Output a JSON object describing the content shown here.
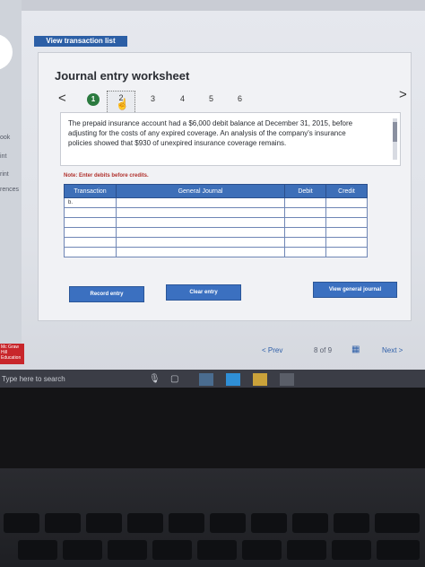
{
  "top": {
    "view_transaction_list": "View transaction list"
  },
  "sidebar": {
    "items": [
      {
        "label": "ook"
      },
      {
        "label": "int"
      },
      {
        "label": "rint"
      },
      {
        "label": "rences"
      }
    ]
  },
  "worksheet": {
    "title": "Journal entry worksheet",
    "prev_arrow": "<",
    "next_arrow": ">",
    "steps": [
      "1",
      "2",
      "3",
      "4",
      "5",
      "6"
    ],
    "current_step": 2,
    "prompt": "The prepaid insurance account had a $6,000 debit balance at December 31, 2015, before adjusting for the costs of any expired coverage. An analysis of the company's insurance policies showed that $930 of unexpired insurance coverage remains.",
    "note": "Note: Enter debits before credits.",
    "table": {
      "headers": [
        "Transaction",
        "General Journal",
        "Debit",
        "Credit"
      ],
      "rows": [
        [
          "b.",
          "",
          "",
          ""
        ],
        [
          "",
          "",
          "",
          ""
        ],
        [
          "",
          "",
          "",
          ""
        ],
        [
          "",
          "",
          "",
          ""
        ],
        [
          "",
          "",
          "",
          ""
        ],
        [
          "",
          "",
          "",
          ""
        ]
      ]
    },
    "buttons": {
      "record": "Record entry",
      "clear": "Clear entry",
      "view_general_journal": "View general journal"
    }
  },
  "footer": {
    "prev": "<  Prev",
    "page_of": "8 of 9",
    "next": "Next  >",
    "logo": "Mc Graw Hill Education"
  },
  "taskbar": {
    "search_placeholder": "Type here to search"
  },
  "colors": {
    "header_blue": "#3d6fb8",
    "button_blue": "#3b70c0",
    "step_green": "#2b7a3f",
    "note_red": "#b0302c",
    "logo_red": "#c8262b"
  }
}
